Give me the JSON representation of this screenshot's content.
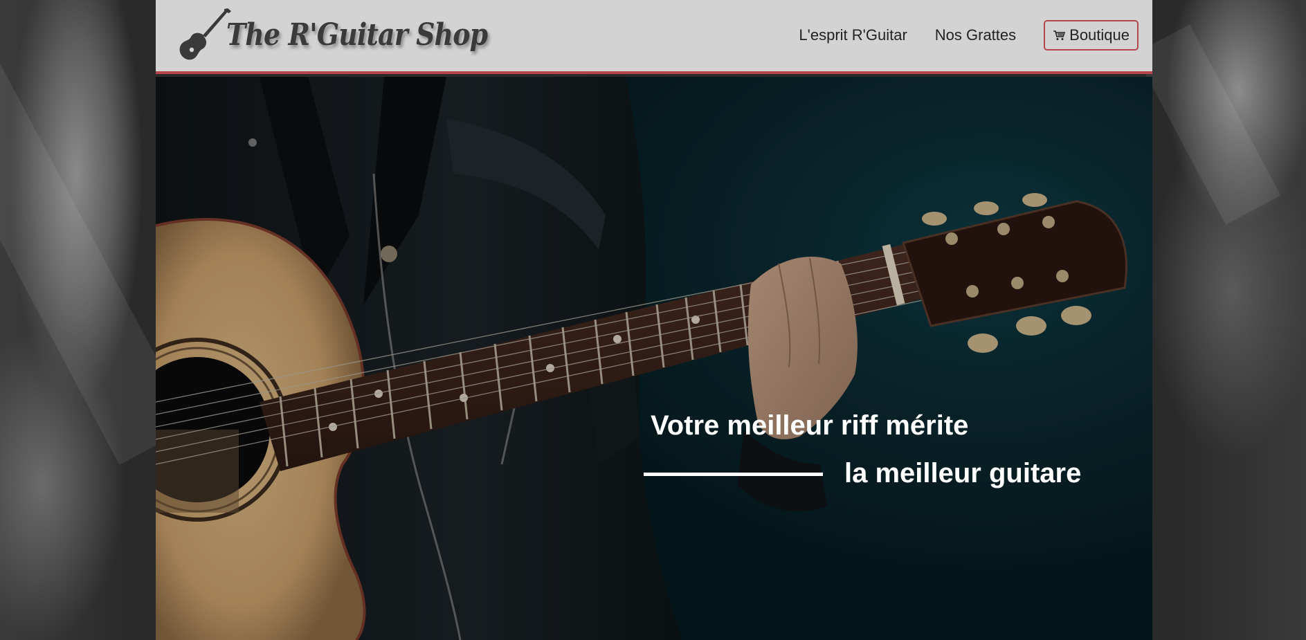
{
  "brand": {
    "name": "The R'Guitar Shop",
    "logo_icon": "guitar-icon"
  },
  "nav": {
    "items": [
      {
        "label": "L'esprit R'Guitar"
      },
      {
        "label": "Nos Grattes"
      }
    ],
    "shop_button": {
      "label": "Boutique",
      "icon": "cart-icon"
    }
  },
  "hero": {
    "line1": "Votre meilleur riff mérite",
    "line2": "la meilleur guitare"
  },
  "colors": {
    "header_bg": "#d3d3d3",
    "accent": "#b5474c",
    "hero_bg": "#0a2a31",
    "text_light": "#ffffff"
  }
}
